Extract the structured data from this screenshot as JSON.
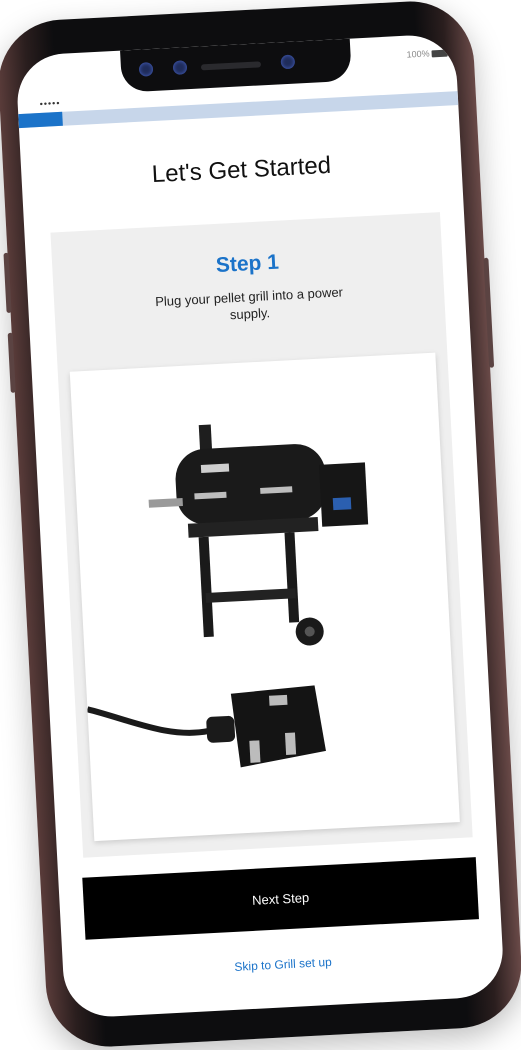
{
  "status": {
    "signal_dots": "•••••",
    "battery_text": "100%"
  },
  "progress": {
    "fraction": 0.1,
    "fill_color": "#1b73c9",
    "track_color": "#c7d6ea"
  },
  "page_title": "Let's Get Started",
  "step": {
    "heading": "Step 1",
    "instruction": "Plug your pellet grill into a power supply.",
    "image": {
      "icon": "pellet-grill-and-plug-illustration"
    }
  },
  "actions": {
    "next_label": "Next Step",
    "skip_label": "Skip to Grill set up"
  },
  "colors": {
    "accent": "#1b73c9",
    "button_bg": "#000000",
    "panel_bg": "#efefef"
  }
}
